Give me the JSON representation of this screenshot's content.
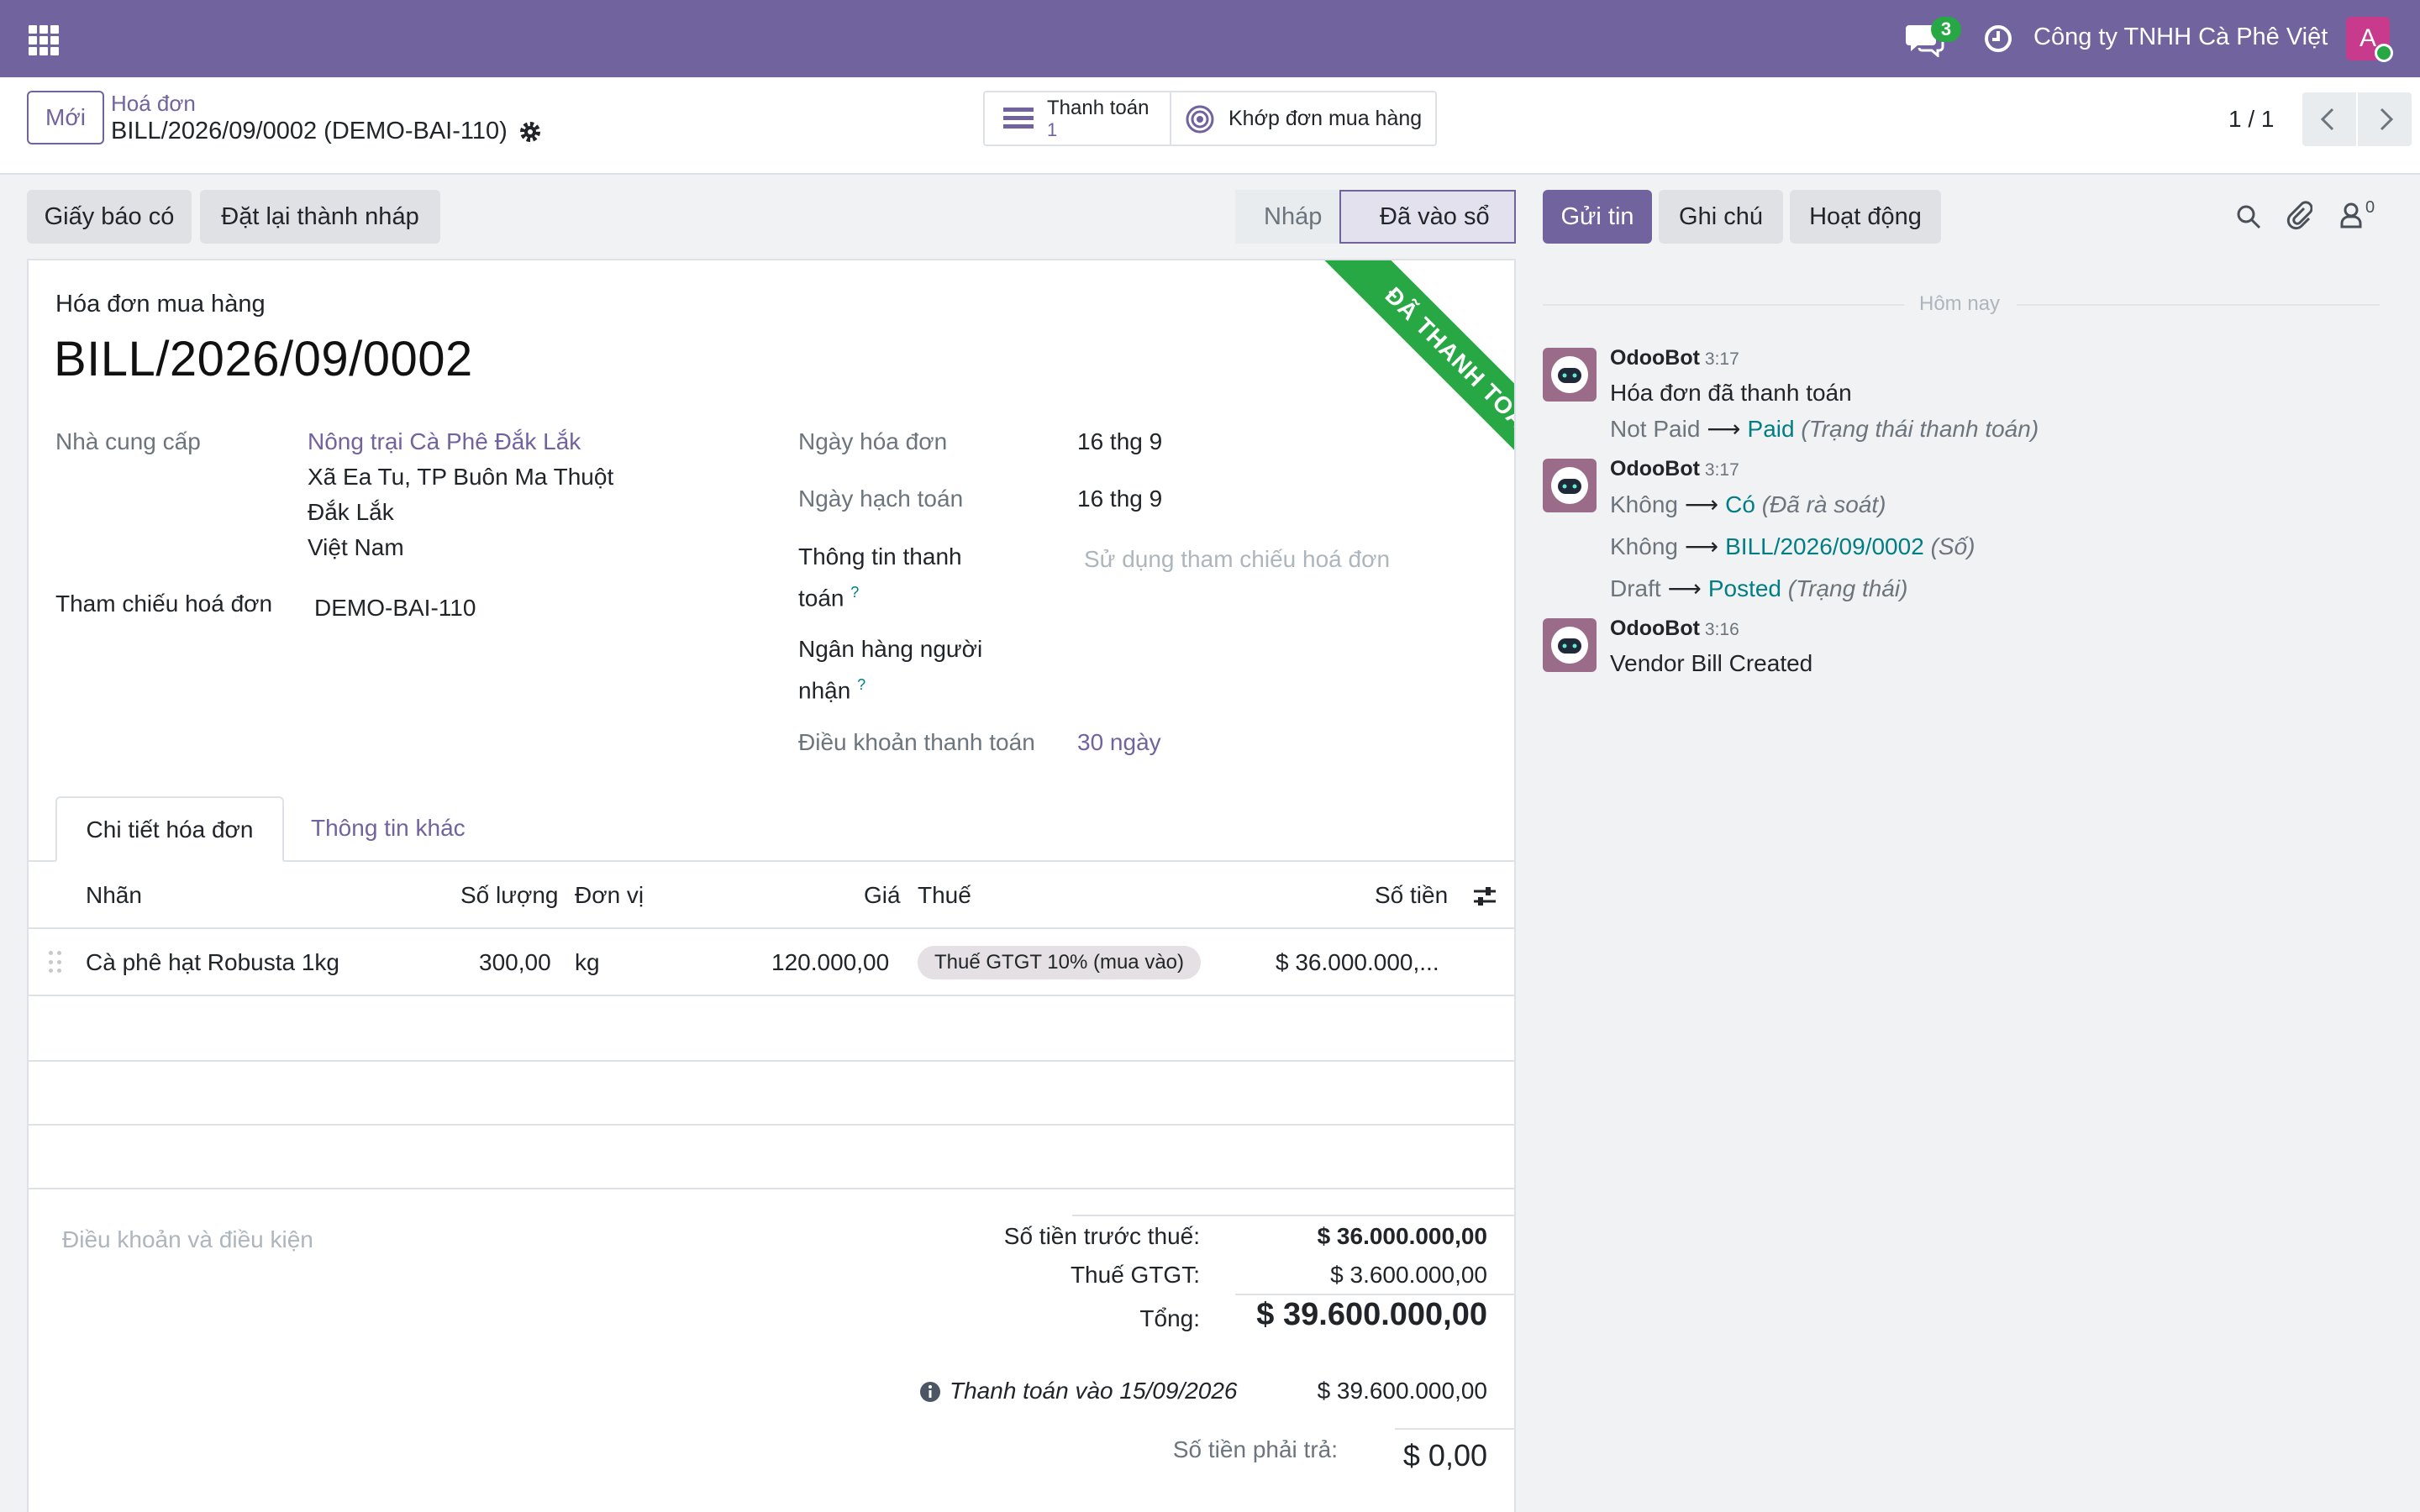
{
  "topbar": {
    "chat_count": "3",
    "company": "Công ty TNHH Cà Phê Việt",
    "avatar_letter": "A"
  },
  "control": {
    "new_label": "Mới",
    "breadcrumb_parent": "Hoá đơn",
    "breadcrumb_current": "BILL/2026/09/0002 (DEMO-BAI-110)",
    "smart_payment_label": "Thanh toán",
    "smart_payment_count": "1",
    "smart_match_label": "Khớp đơn mua hàng",
    "pager": "1 / 1"
  },
  "actions": {
    "credit_note": "Giấy báo có",
    "reset_draft": "Đặt lại thành nháp"
  },
  "statusbar": {
    "draft": "Nháp",
    "posted": "Đã vào sổ"
  },
  "ribbon": "ĐÃ THANH TOÁN",
  "form": {
    "doc_type": "Hóa đơn mua hàng",
    "name": "BILL/2026/09/0002",
    "vendor_label": "Nhà cung cấp",
    "vendor_name": "Nông trại Cà Phê Đắk Lắk",
    "vendor_addr1": "Xã Ea Tu, TP Buôn Ma Thuột",
    "vendor_addr2": "Đắk Lắk",
    "vendor_addr3": "Việt Nam",
    "ref_label": "Tham chiếu hoá đơn",
    "ref_value": "DEMO-BAI-110",
    "invoice_date_label": "Ngày hóa đơn",
    "invoice_date": "16 thg 9",
    "accounting_date_label": "Ngày hạch toán",
    "accounting_date": "16 thg 9",
    "payment_ref_label_1": "Thông tin thanh",
    "payment_ref_label_2": "toán",
    "payment_ref_placeholder": "Sử dụng tham chiếu hoá đơn",
    "bank_label_1": "Ngân hàng người",
    "bank_label_2": "nhận",
    "help_mark": "?",
    "terms_label": "Điều khoản thanh toán",
    "terms_value": "30 ngày"
  },
  "tabs": {
    "lines": "Chi tiết hóa đơn",
    "other": "Thông tin khác"
  },
  "table": {
    "headers": {
      "label": "Nhãn",
      "qty": "Số lượng",
      "uom": "Đơn vị",
      "price": "Giá",
      "tax": "Thuế",
      "amount": "Số tiền"
    },
    "rows": [
      {
        "label": "Cà phê hạt Robusta 1kg",
        "qty": "300,00",
        "uom": "kg",
        "price": "120.000,00",
        "tax": "Thuế GTGT 10% (mua vào)",
        "amount": "$ 36.000.000,..."
      }
    ]
  },
  "footer": {
    "terms_placeholder": "Điều khoản và điều kiện",
    "untaxed_label": "Số tiền trước thuế:",
    "untaxed_value": "$ 36.000.000,00",
    "vat_label": "Thuế GTGT:",
    "vat_value": "$ 3.600.000,00",
    "total_label": "Tổng:",
    "total_value": "$ 39.600.000,00",
    "payment_line": "Thanh toán vào 15/09/2026",
    "payment_amount": "$ 39.600.000,00",
    "residual_label": "Số tiền phải trả:",
    "residual_value": "$ 0,00"
  },
  "chatter": {
    "send_message": "Gửi tin",
    "log_note": "Ghi chú",
    "activity": "Hoạt động",
    "followers_count": "0",
    "today": "Hôm nay",
    "messages": [
      {
        "author": "OdooBot",
        "time": "3:17",
        "body": "Hóa đơn đã thanh toán",
        "tracking": [
          {
            "old": "Not Paid",
            "new": "Paid",
            "field": "(Trạng thái thanh toán)"
          }
        ]
      },
      {
        "author": "OdooBot",
        "time": "3:17",
        "body": "",
        "tracking": [
          {
            "old": "Không",
            "new": "Có",
            "field": "(Đã rà soát)"
          },
          {
            "old": "Không",
            "new": "BILL/2026/09/0002",
            "field": "(Số)"
          },
          {
            "old": "Draft",
            "new": "Posted",
            "field": "(Trạng thái)"
          }
        ]
      },
      {
        "author": "OdooBot",
        "time": "3:16",
        "body": "Vendor Bill Created",
        "tracking": []
      }
    ]
  },
  "colors": {
    "brand": "#71639e",
    "paid_ribbon": "#28a745",
    "tracking_new": "#017e84"
  }
}
